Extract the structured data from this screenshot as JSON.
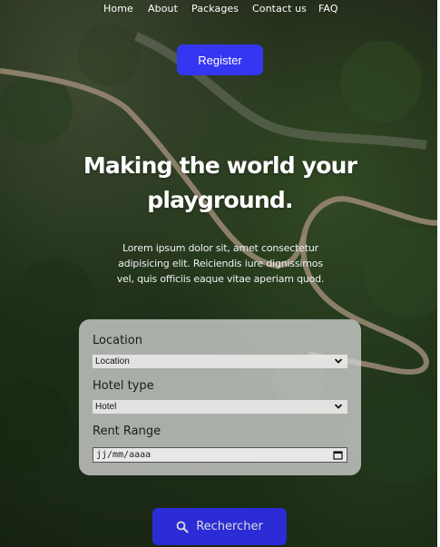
{
  "nav": {
    "items": [
      "Home",
      "About",
      "Packages",
      "Contact us",
      "FAQ"
    ]
  },
  "register": {
    "label": "Register"
  },
  "hero": {
    "title_line1": "Making the world your",
    "title_line2": "playground.",
    "lead_line1": "Lorem ipsum dolor sit, amet consectetur",
    "lead_line2": "adipisicing elit. Reiciendis iure dignissimos",
    "lead_line3": "vel, quis officiis eaque vitae aperiam quod."
  },
  "form": {
    "location_label": "Location",
    "location_value": "Location",
    "hotel_type_label": "Hotel type",
    "hotel_type_value": "Hotel",
    "rent_range_label": "Rent Range",
    "rent_range_placeholder": "jj/mm/aaaa"
  },
  "search": {
    "label": "Rechercher",
    "icon": "search-icon"
  },
  "colors": {
    "accent": "#3536f2",
    "search_bg": "#2b2cd6",
    "card_bg": "rgba(210,210,210,0.78)"
  }
}
